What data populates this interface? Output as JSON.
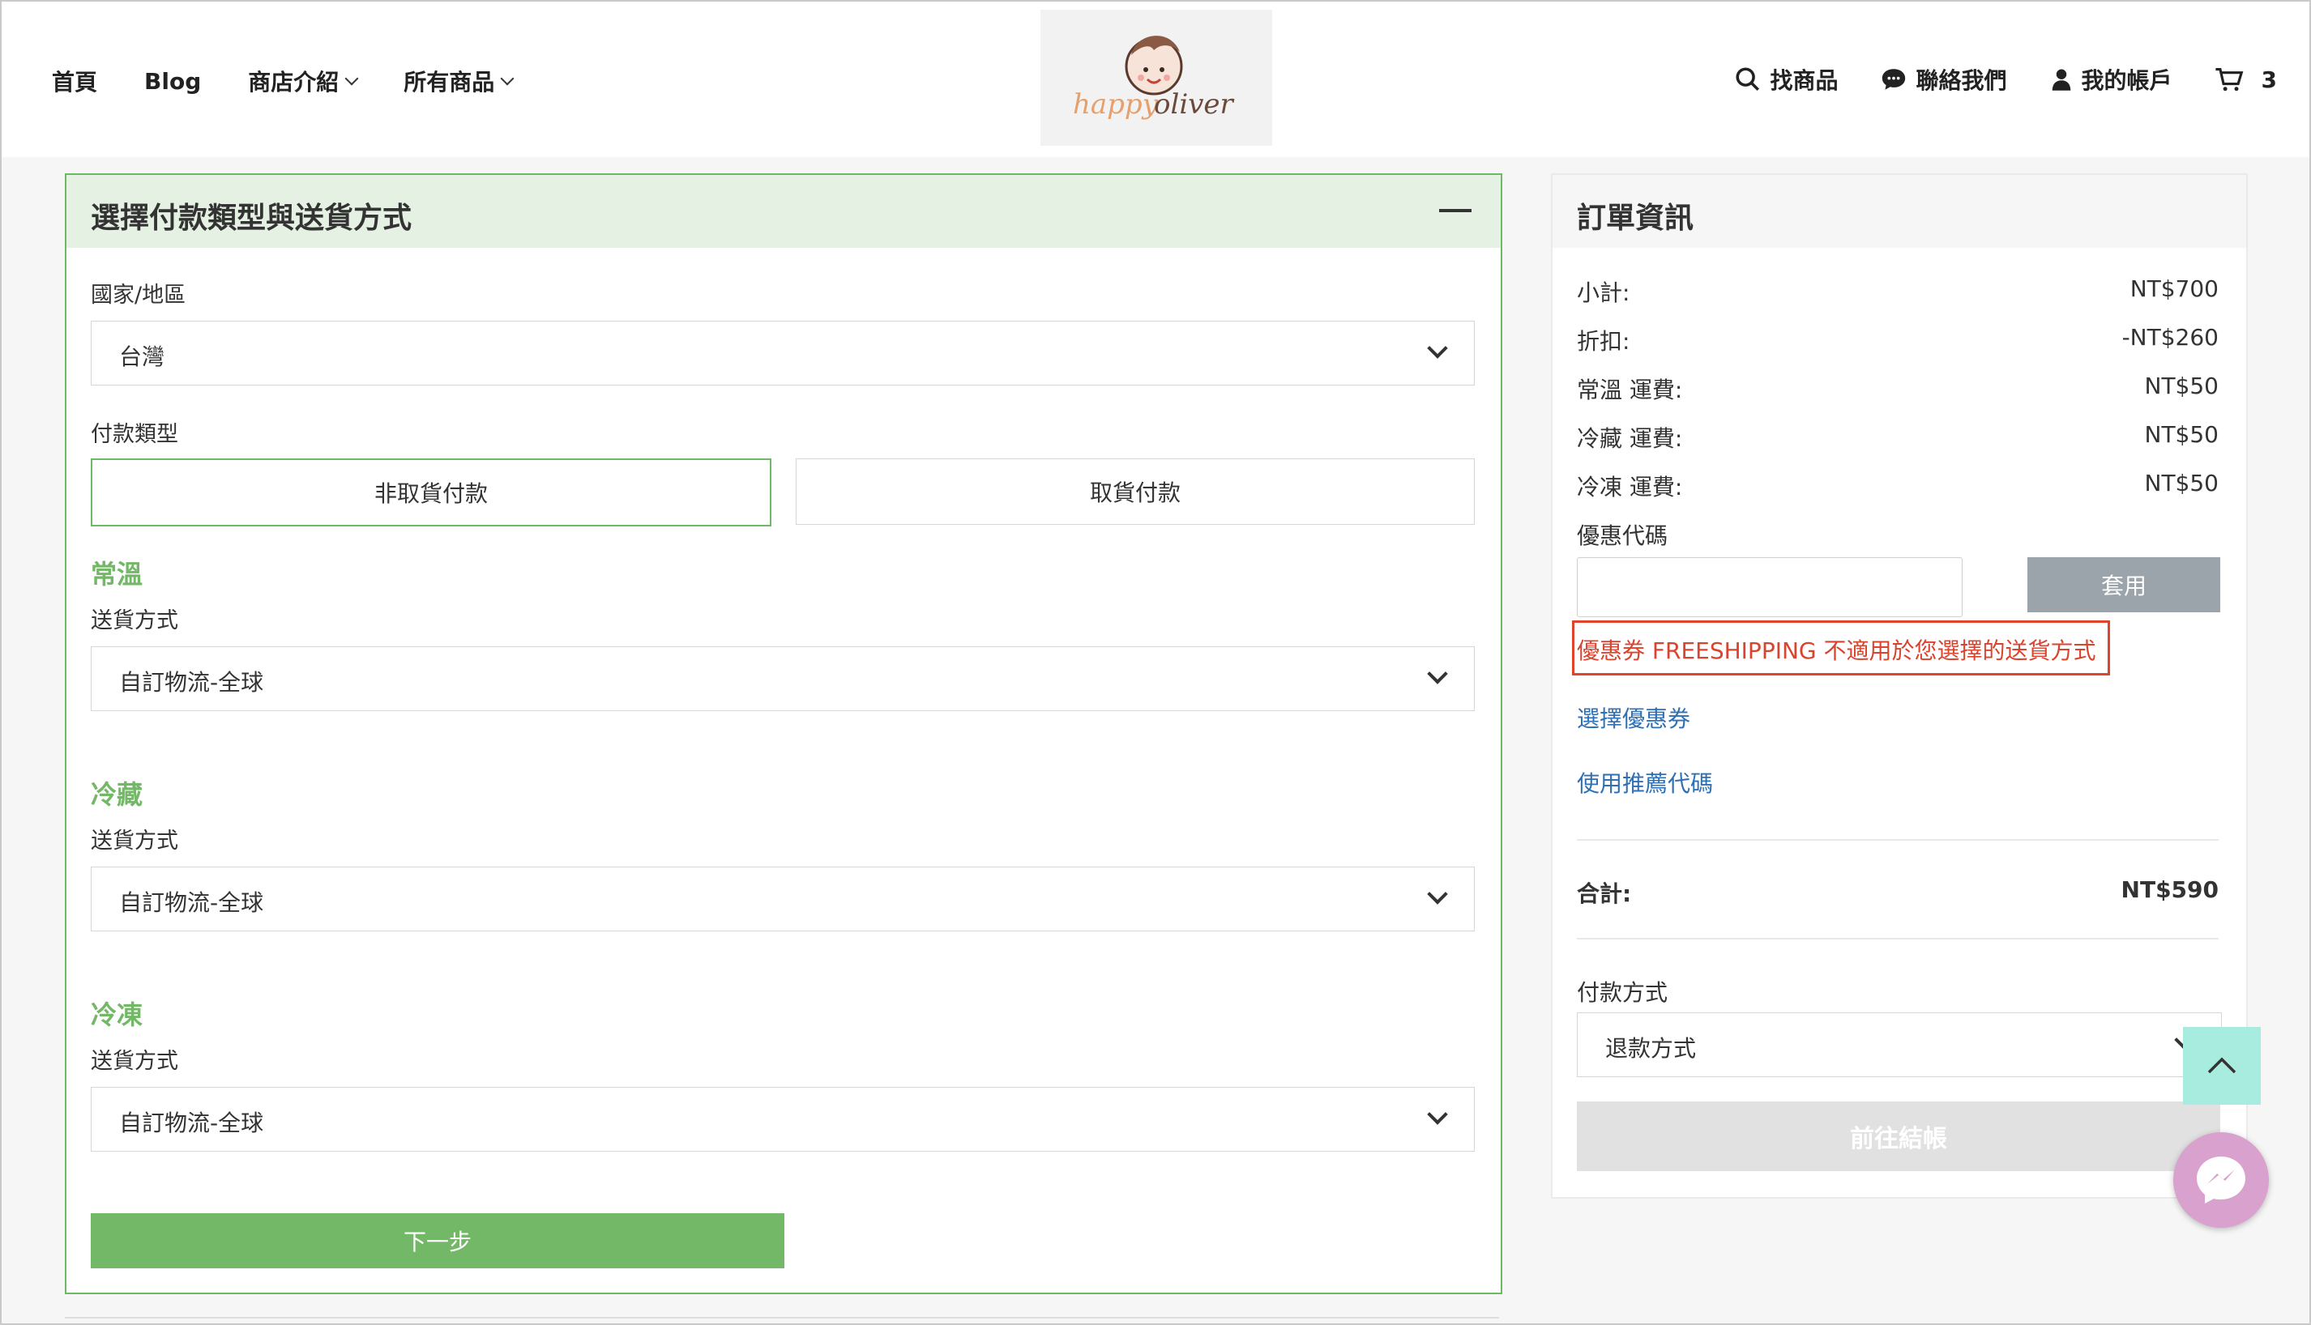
{
  "header": {
    "nav": [
      {
        "label": "首頁"
      },
      {
        "label": "Blog"
      },
      {
        "label": "商店介紹"
      },
      {
        "label": "所有商品"
      }
    ],
    "logo_text": "happyoliver",
    "search_label": "找商品",
    "contact_label": "聯絡我們",
    "account_label": "我的帳戶",
    "cart_count": "3"
  },
  "checkout": {
    "title": "選擇付款類型與送貨方式",
    "country_label": "國家/地區",
    "country_value": "台灣",
    "payment_type_label": "付款類型",
    "payment_types": [
      "非取貨付款",
      "取貨付款"
    ],
    "groups": [
      {
        "heading": "常溫",
        "shipping_label": "送貨方式",
        "shipping_value": "自訂物流-全球"
      },
      {
        "heading": "冷藏",
        "shipping_label": "送貨方式",
        "shipping_value": "自訂物流-全球"
      },
      {
        "heading": "冷凍",
        "shipping_label": "送貨方式",
        "shipping_value": "自訂物流-全球"
      }
    ],
    "next_button": "下一步"
  },
  "order": {
    "title": "訂單資訊",
    "rows": [
      {
        "label": "小計:",
        "value": "NT$700"
      },
      {
        "label": "折扣:",
        "value": "-NT$260"
      },
      {
        "label": "常溫 運費:",
        "value": "NT$50"
      },
      {
        "label": "冷藏 運費:",
        "value": "NT$50"
      },
      {
        "label": "冷凍 運費:",
        "value": "NT$50"
      }
    ],
    "coupon_label": "優惠代碼",
    "coupon_value": "",
    "apply_button": "套用",
    "coupon_error": "優惠券 FREESHIPPING 不適用於您選擇的送貨方式",
    "choose_coupon_link": "選擇優惠券",
    "referral_link": "使用推薦代碼",
    "total_label": "合計:",
    "total_value": "NT$590",
    "payment_method_label": "付款方式",
    "payment_method_value": "退款方式",
    "checkout_button": "前往結帳"
  },
  "colors": {
    "accent_green": "#72b866",
    "error_red": "#d9442e",
    "link_blue": "#2f70b5"
  }
}
